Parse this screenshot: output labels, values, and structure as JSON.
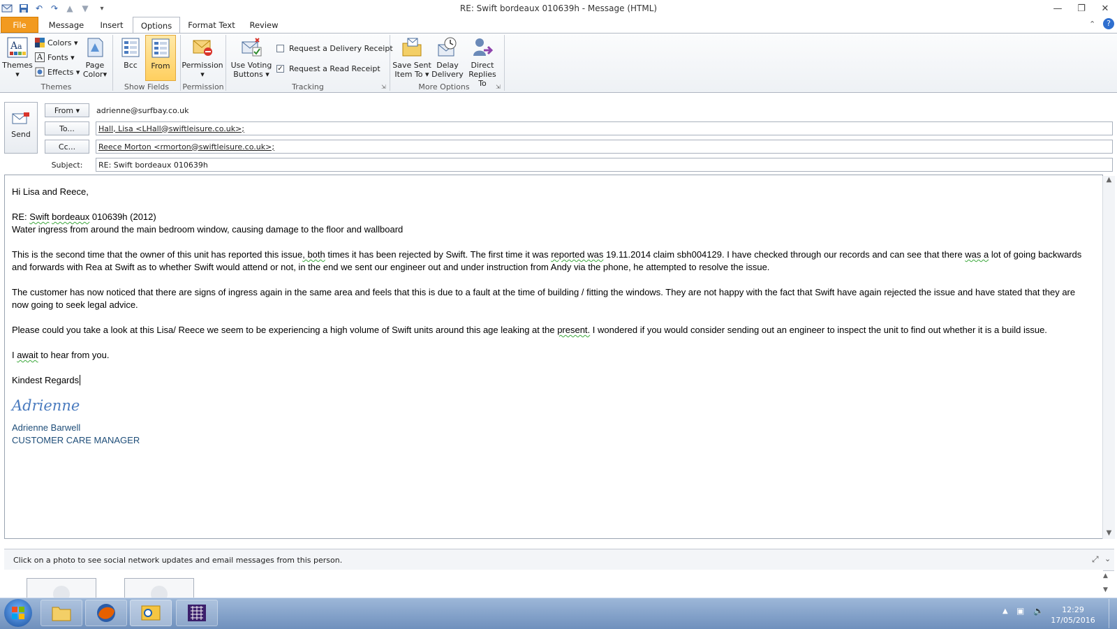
{
  "window": {
    "title": "RE: Swift  bordeaux 010639h  -  Message (HTML)"
  },
  "tabs": [
    "File",
    "Message",
    "Insert",
    "Options",
    "Format Text",
    "Review"
  ],
  "ribbon": {
    "themes_group": {
      "label": "Themes",
      "themes_btn": "Themes",
      "colors": "Colors",
      "fonts": "Fonts",
      "effects": "Effects",
      "page_color_1": "Page",
      "page_color_2": "Color"
    },
    "show_fields_group": {
      "label": "Show Fields",
      "bcc": "Bcc",
      "from": "From"
    },
    "permission_group": {
      "label": "Permission",
      "permission": "Permission"
    },
    "tracking_group": {
      "label": "Tracking",
      "voting_1": "Use Voting",
      "voting_2": "Buttons",
      "delivery_receipt": "Request a Delivery Receipt",
      "read_receipt": "Request a Read Receipt",
      "delivery_receipt_checked": false,
      "read_receipt_checked": true
    },
    "more_options_group": {
      "label": "More Options",
      "save_sent_1": "Save Sent",
      "save_sent_2": "Item To",
      "delay_1": "Delay",
      "delay_2": "Delivery",
      "direct_1": "Direct",
      "direct_2": "Replies To"
    }
  },
  "header": {
    "send": "Send",
    "from_btn": "From",
    "from_value": "adrienne@surfbay.co.uk",
    "to_btn": "To...",
    "to_value": "Hall, Lisa <LHall@swiftleisure.co.uk>;",
    "cc_btn": "Cc...",
    "cc_value": "Reece Morton <rmorton@swiftleisure.co.uk>;",
    "subject_label": "Subject:",
    "subject_value": "RE: Swift  bordeaux 010639h"
  },
  "body": {
    "greeting": "Hi Lisa and Reece,",
    "re_prefix": "RE: ",
    "re_swift": "Swift",
    "re_space": " ",
    "re_bordeaux": "bordeaux",
    "re_rest": " 010639h (2012)",
    "issue_line": "Water ingress from around the main bedroom window, causing damage to the floor and wallboard",
    "p1a": "This is the second time that the owner of this unit has reported this issue",
    "p1b": ",  both",
    "p1c": " times it has been rejected by Swift.  The first time it was ",
    "p1d": "reported  was",
    "p1e": " 19.11.2014 claim sbh004129.   I have checked through our records and can see that there ",
    "p1f": "was  a",
    "p1g": " lot of going backwards and forwards with Rea at Swift as to whether Swift would attend or not, in the end we sent our engineer out and under instruction from Andy via the phone, he attempted to resolve the issue.",
    "p2": "The customer has now noticed that there are signs of ingress again in the same area and feels that this is due to a fault at the time of building / fitting the windows.  They are not happy with the fact that Swift have again rejected the issue and have stated that they are now going to seek legal advice.",
    "p3a": "Please could you take a look at this Lisa/ Reece we seem to be experiencing a high volume of Swift units around this age leaking at the ",
    "p3b": "present.",
    "p3c": "  I wondered if you would consider sending out an engineer to inspect the unit to find out whether it is a build issue.",
    "p4a": "I ",
    "p4b": "await",
    "p4c": " to hear from you.",
    "closing": "Kindest Regards",
    "signature_script": "Adrienne",
    "sig_name": "Adrienne Barwell",
    "sig_title": "CUSTOMER CARE MANAGER"
  },
  "people_pane": {
    "hint": "Click on a photo to see social network updates and email messages from this person."
  },
  "taskbar": {
    "time": "12:29",
    "date": "17/05/2016"
  }
}
